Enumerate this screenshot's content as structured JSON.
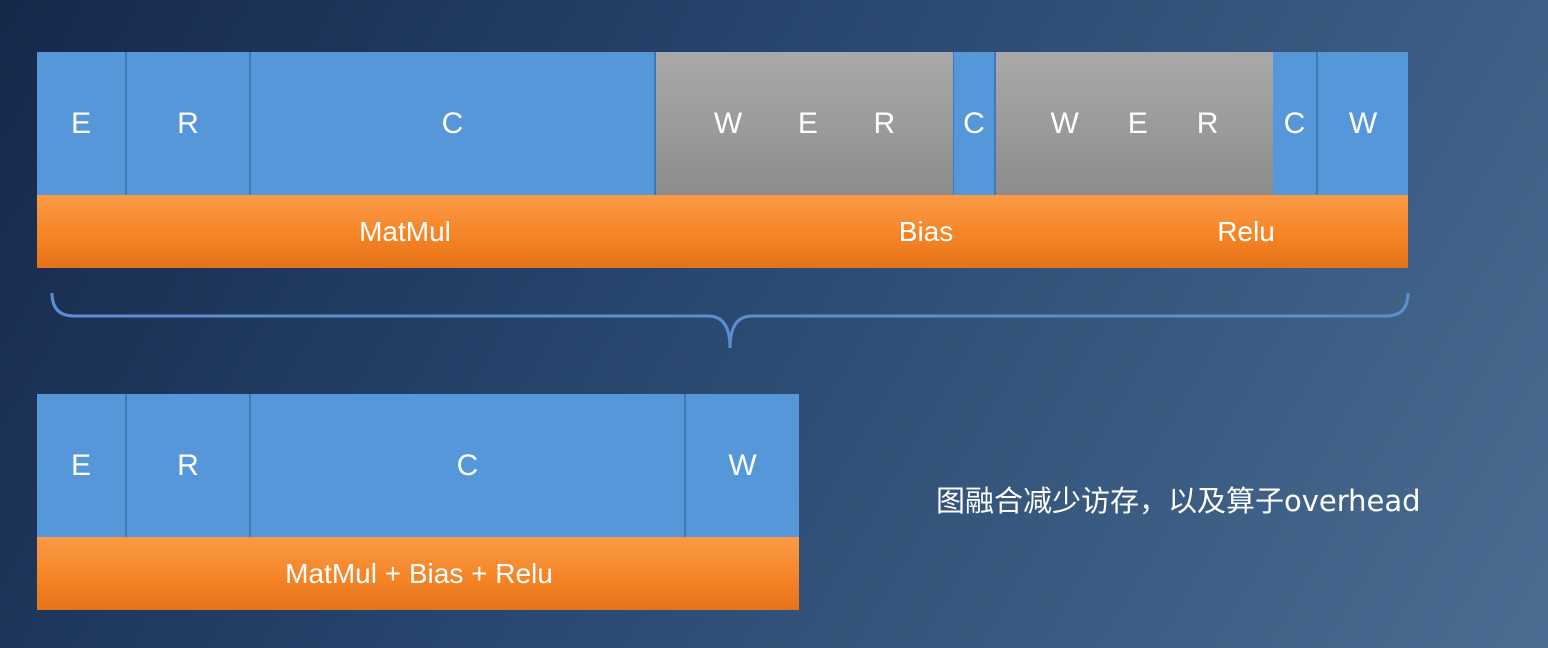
{
  "top": {
    "stages": [
      {
        "type": "blue",
        "label": "E"
      },
      {
        "type": "blue",
        "label": "R"
      },
      {
        "type": "blue",
        "label": "C"
      },
      {
        "type": "gray",
        "labels": [
          "W",
          "E",
          "R"
        ]
      },
      {
        "type": "blue",
        "label": "C"
      },
      {
        "type": "gray",
        "labels": [
          "W",
          "E",
          "R"
        ]
      },
      {
        "type": "blue",
        "label": "C"
      },
      {
        "type": "blue",
        "label": "W"
      }
    ],
    "ops": [
      "MatMul",
      "Bias",
      "Relu"
    ]
  },
  "bottom": {
    "stages": [
      {
        "type": "blue",
        "label": "E"
      },
      {
        "type": "blue",
        "label": "R"
      },
      {
        "type": "blue",
        "label": "C"
      },
      {
        "type": "blue",
        "label": "W"
      }
    ],
    "op": "MatMul + Bias + Relu"
  },
  "note": "图融合减少访存，以及算子overhead",
  "colors": {
    "compute": "#5597d8",
    "memory": "#9a9a9a",
    "operator": "#f58526",
    "brace": "#5d8fd0"
  }
}
